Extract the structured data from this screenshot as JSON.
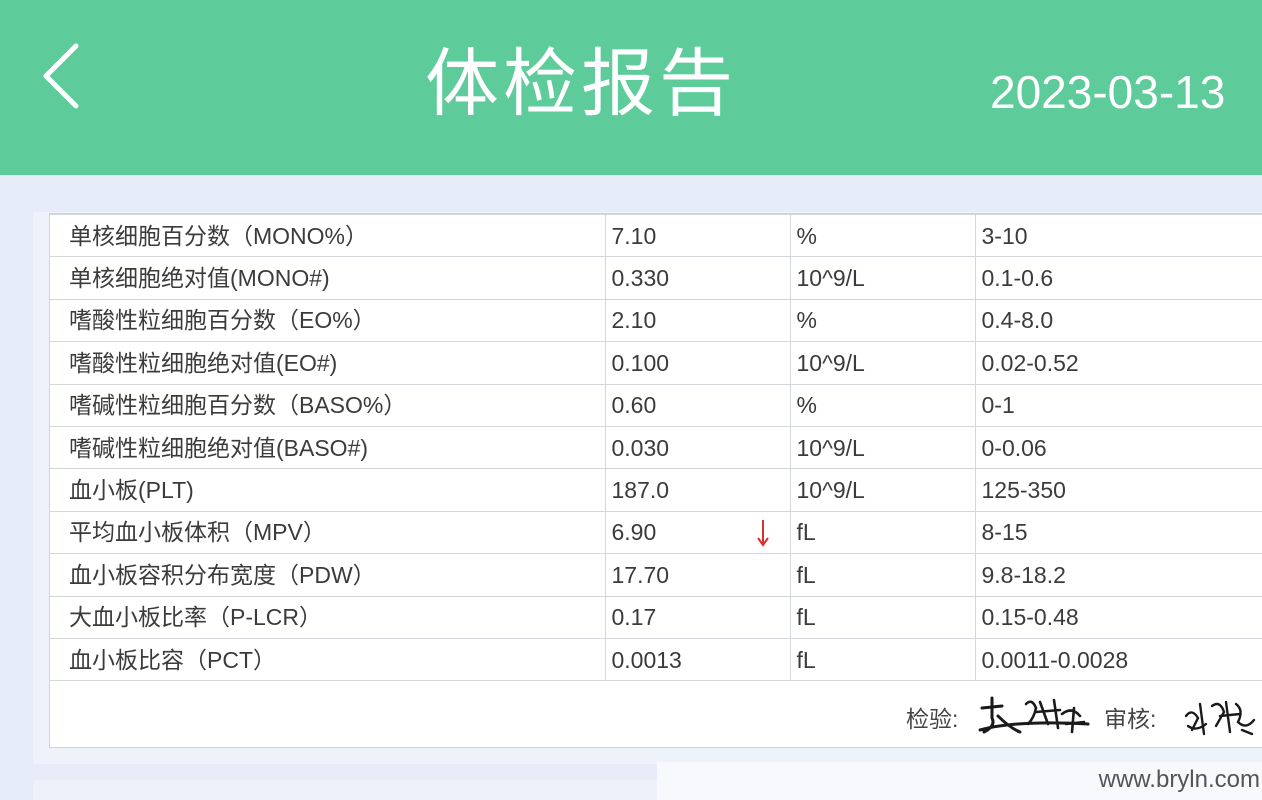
{
  "header": {
    "title": "体检报告",
    "date": "2023-03-13"
  },
  "colors": {
    "header_bg": "#5ecb9b",
    "page_bg": "#e6ecf8",
    "flag_low": "#d9302c"
  },
  "table": {
    "rows": [
      {
        "name": "单核细胞百分数（MONO%）",
        "result": "7.10",
        "flag": "",
        "unit": "%",
        "range": "3-10"
      },
      {
        "name": "单核细胞绝对值(MONO#)",
        "result": "0.330",
        "flag": "",
        "unit": "10^9/L",
        "range": "0.1-0.6"
      },
      {
        "name": "嗜酸性粒细胞百分数（EO%）",
        "result": "2.10",
        "flag": "",
        "unit": "%",
        "range": "0.4-8.0"
      },
      {
        "name": "嗜酸性粒细胞绝对值(EO#)",
        "result": "0.100",
        "flag": "",
        "unit": "10^9/L",
        "range": "0.02-0.52"
      },
      {
        "name": "嗜碱性粒细胞百分数（BASO%）",
        "result": "0.60",
        "flag": "",
        "unit": "%",
        "range": "0-1"
      },
      {
        "name": "嗜碱性粒细胞绝对值(BASO#)",
        "result": "0.030",
        "flag": "",
        "unit": "10^9/L",
        "range": "0-0.06"
      },
      {
        "name": "血小板(PLT)",
        "result": "187.0",
        "flag": "",
        "unit": "10^9/L",
        "range": "125-350"
      },
      {
        "name": "平均血小板体积（MPV）",
        "result": "6.90",
        "flag": "down-arrow-icon",
        "unit": "fL",
        "range": "8-15"
      },
      {
        "name": "血小板容积分布宽度（PDW）",
        "result": "17.70",
        "flag": "",
        "unit": "fL",
        "range": "9.8-18.2"
      },
      {
        "name": "大血小板比率（P-LCR）",
        "result": "0.17",
        "flag": "",
        "unit": "fL",
        "range": "0.15-0.48"
      },
      {
        "name": "血小板比容（PCT）",
        "result": "0.0013",
        "flag": "",
        "unit": "fL",
        "range": "0.0011-0.0028"
      }
    ]
  },
  "signature": {
    "inspector_label": "检验:",
    "reviewer_label": "审核:"
  },
  "watermark": "www.bryln.com"
}
